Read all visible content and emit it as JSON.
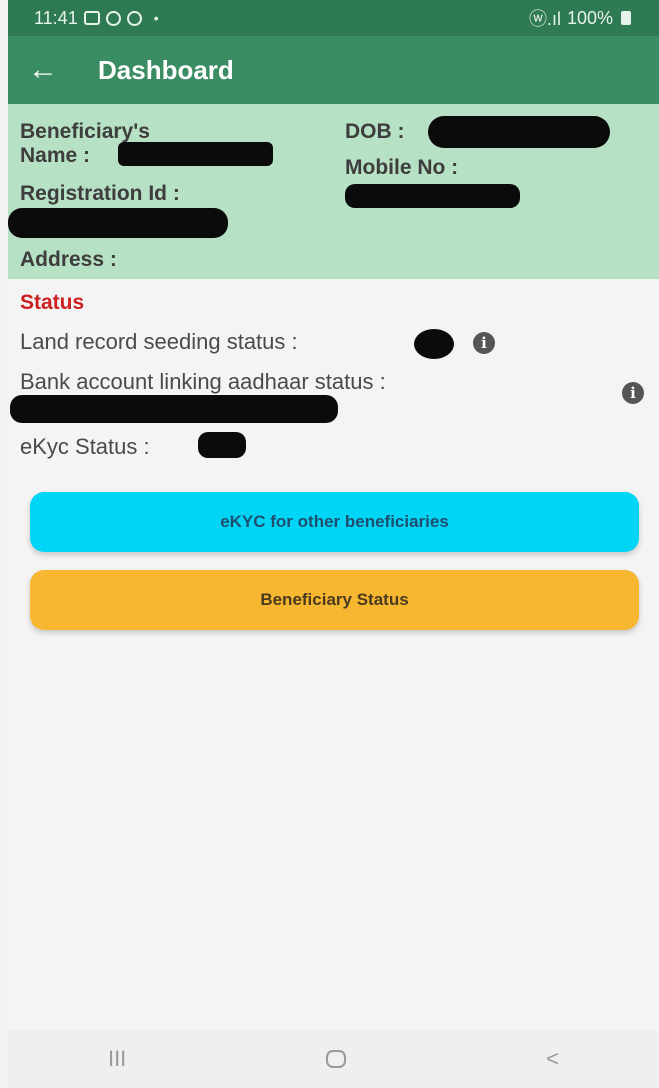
{
  "statusbar": {
    "time": "11:41",
    "dot": "•",
    "signal": "ⓦ.ıl",
    "battery": "100%"
  },
  "appbar": {
    "back_glyph": "←",
    "title": "Dashboard"
  },
  "beneficiary": {
    "name_label_line1": "Beneficiary's",
    "name_label_line2": "Name :",
    "registration_label": "Registration Id :",
    "address_label": "Address :",
    "dob_label": "DOB :",
    "mobile_label": "Mobile No :"
  },
  "status": {
    "title": "Status",
    "land_record_label": "Land record seeding status :",
    "bank_linking_label": "Bank account linking aadhaar status :",
    "ekyc_label": "eKyc Status :",
    "info_glyph": "i"
  },
  "buttons": {
    "ekyc_other": "eKYC for other beneficiaries",
    "beneficiary_status": "Beneficiary Status"
  },
  "navbar": {
    "recents_glyph": "III",
    "back_glyph": "<"
  },
  "colors": {
    "statusbar": "#2e7a53",
    "appbar": "#3a8c63",
    "info_panel": "#b7e1c5",
    "status_title": "#cc1f1f",
    "ekyc_button": "#00d5f5",
    "status_button": "#f7b731"
  },
  "icons": {
    "back": "arrow-left-icon",
    "info": "info-circle-icon",
    "home": "home-icon",
    "recents": "recents-icon",
    "nav_back": "chevron-left-icon"
  }
}
